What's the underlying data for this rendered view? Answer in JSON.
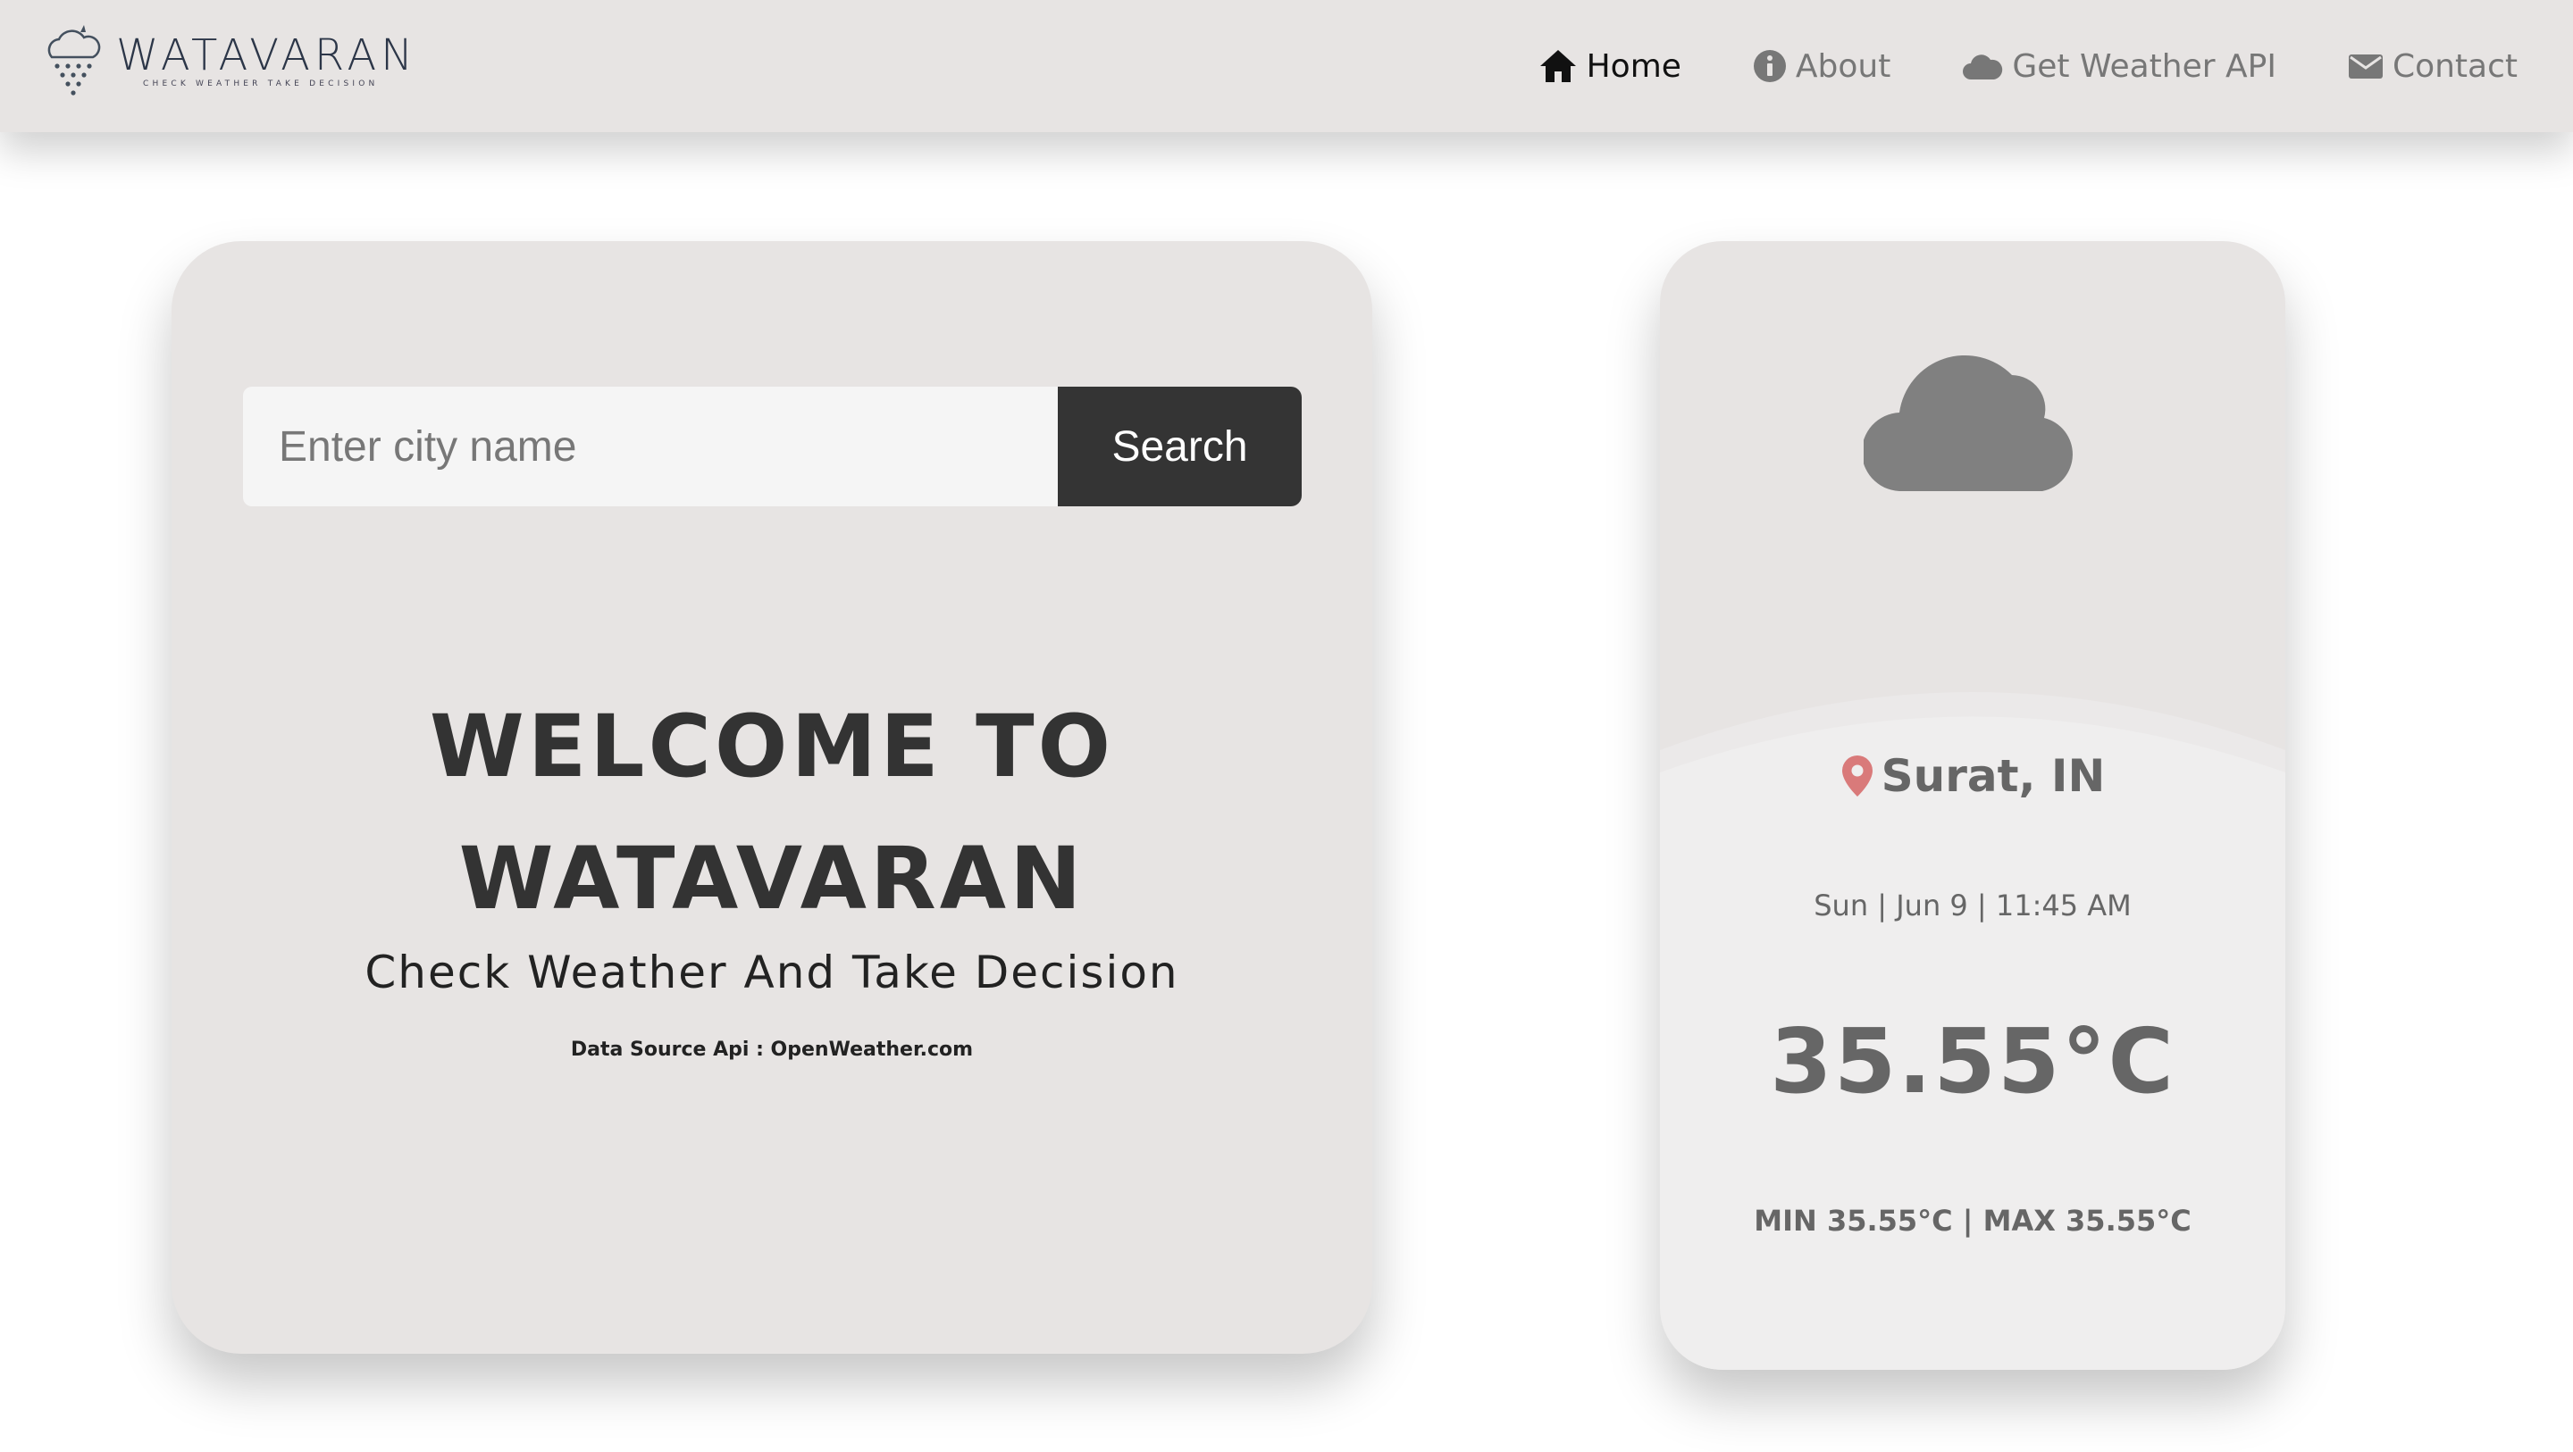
{
  "brand": {
    "name": "WATAVARAN",
    "tagline": "CHECK WEATHER TAKE DECISION"
  },
  "nav": {
    "items": [
      {
        "label": "Home",
        "icon": "home-icon",
        "active": true
      },
      {
        "label": "About",
        "icon": "info-icon",
        "active": false
      },
      {
        "label": "Get Weather API",
        "icon": "cloud-icon",
        "active": false
      },
      {
        "label": "Contact",
        "icon": "envelope-icon",
        "active": false
      }
    ]
  },
  "search": {
    "placeholder": "Enter city name",
    "value": "",
    "button_label": "Search"
  },
  "hero": {
    "welcome_line1": "WELCOME TO",
    "welcome_line2": "WATAVARAN",
    "subtitle": "Check Weather And Take Decision",
    "source": "Data Source Api : OpenWeather.com"
  },
  "weather": {
    "icon": "cloud-icon",
    "location": "Surat, IN",
    "datetime": "Sun | Jun 9 | 11:45 AM",
    "temperature": "35.55°C",
    "minmax": "MIN 35.55°C | MAX 35.55°C"
  },
  "colors": {
    "nav_background": "#e7e4e3",
    "card_background": "#e7e4e3",
    "card_lower_background": "#efeeee",
    "search_button": "#343434",
    "location_pin": "#d97a7a",
    "weather_icon": "#808080"
  }
}
